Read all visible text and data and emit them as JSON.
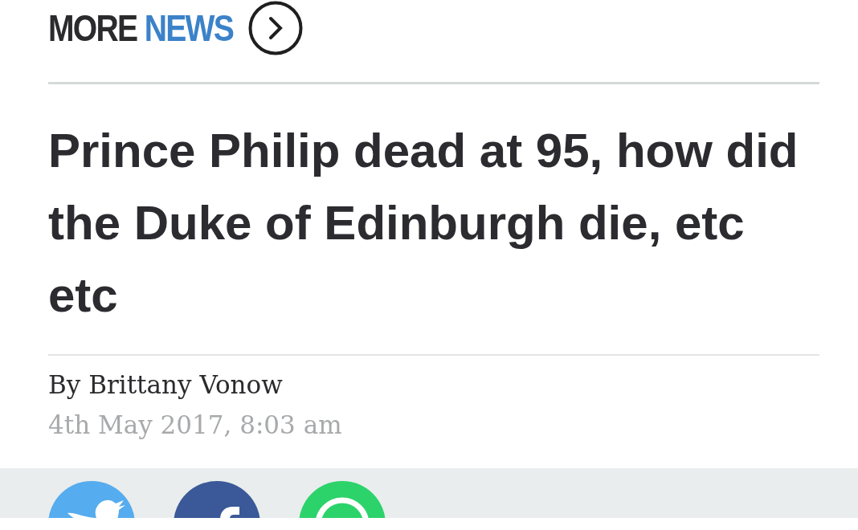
{
  "header": {
    "title_first": "MORE",
    "title_second": "NEWS"
  },
  "article": {
    "headline": "Prince Philip dead at 95, how did the Duke of Edinburgh die, etc etc",
    "byline": "By Brittany Vonow",
    "date": "4th May 2017, 8:03 am"
  },
  "share": [
    {
      "kind": "twitter"
    },
    {
      "kind": "facebook"
    },
    {
      "kind": "whatsapp"
    }
  ]
}
